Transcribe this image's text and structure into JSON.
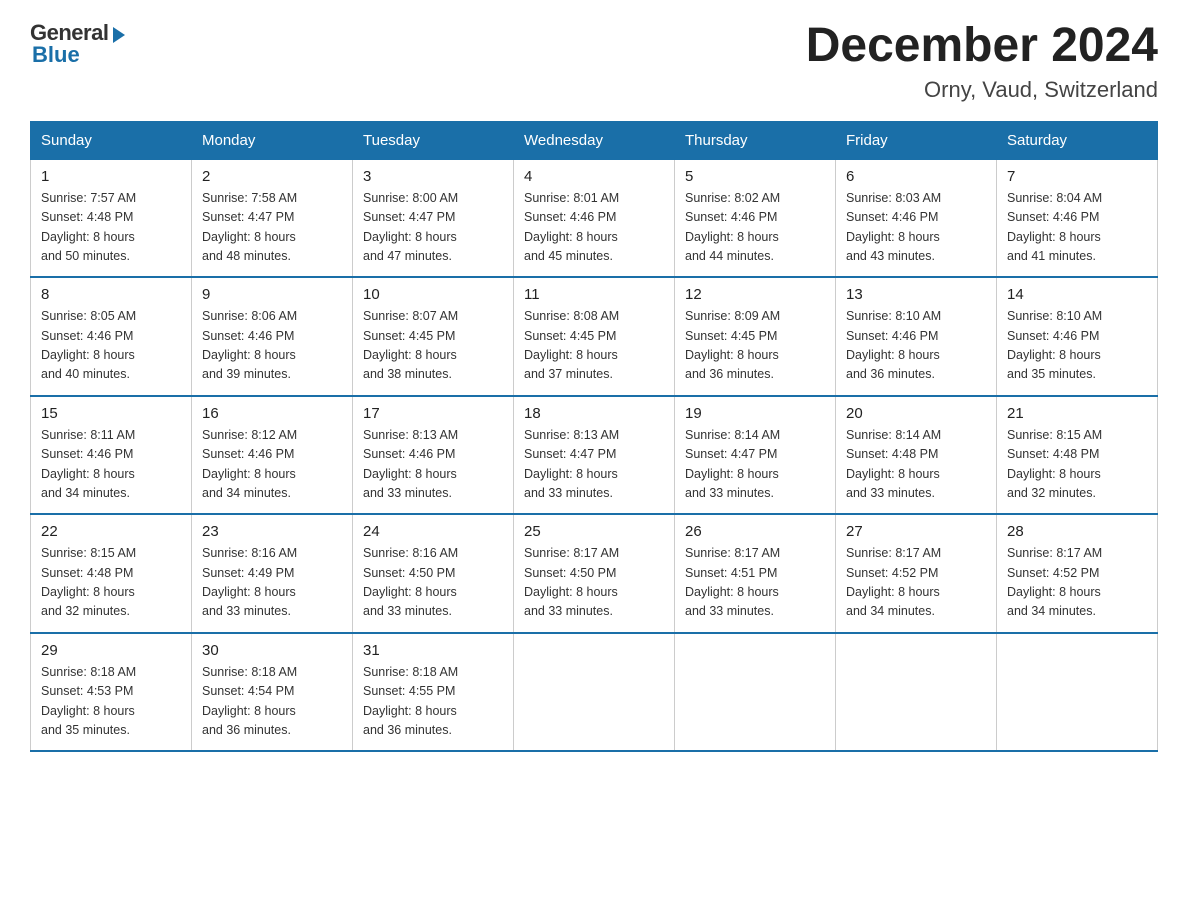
{
  "header": {
    "logo_general": "General",
    "logo_blue": "Blue",
    "title": "December 2024",
    "location": "Orny, Vaud, Switzerland"
  },
  "weekdays": [
    "Sunday",
    "Monday",
    "Tuesday",
    "Wednesday",
    "Thursday",
    "Friday",
    "Saturday"
  ],
  "weeks": [
    [
      {
        "day": "1",
        "sunrise": "7:57 AM",
        "sunset": "4:48 PM",
        "daylight": "8 hours and 50 minutes."
      },
      {
        "day": "2",
        "sunrise": "7:58 AM",
        "sunset": "4:47 PM",
        "daylight": "8 hours and 48 minutes."
      },
      {
        "day": "3",
        "sunrise": "8:00 AM",
        "sunset": "4:47 PM",
        "daylight": "8 hours and 47 minutes."
      },
      {
        "day": "4",
        "sunrise": "8:01 AM",
        "sunset": "4:46 PM",
        "daylight": "8 hours and 45 minutes."
      },
      {
        "day": "5",
        "sunrise": "8:02 AM",
        "sunset": "4:46 PM",
        "daylight": "8 hours and 44 minutes."
      },
      {
        "day": "6",
        "sunrise": "8:03 AM",
        "sunset": "4:46 PM",
        "daylight": "8 hours and 43 minutes."
      },
      {
        "day": "7",
        "sunrise": "8:04 AM",
        "sunset": "4:46 PM",
        "daylight": "8 hours and 41 minutes."
      }
    ],
    [
      {
        "day": "8",
        "sunrise": "8:05 AM",
        "sunset": "4:46 PM",
        "daylight": "8 hours and 40 minutes."
      },
      {
        "day": "9",
        "sunrise": "8:06 AM",
        "sunset": "4:46 PM",
        "daylight": "8 hours and 39 minutes."
      },
      {
        "day": "10",
        "sunrise": "8:07 AM",
        "sunset": "4:45 PM",
        "daylight": "8 hours and 38 minutes."
      },
      {
        "day": "11",
        "sunrise": "8:08 AM",
        "sunset": "4:45 PM",
        "daylight": "8 hours and 37 minutes."
      },
      {
        "day": "12",
        "sunrise": "8:09 AM",
        "sunset": "4:45 PM",
        "daylight": "8 hours and 36 minutes."
      },
      {
        "day": "13",
        "sunrise": "8:10 AM",
        "sunset": "4:46 PM",
        "daylight": "8 hours and 36 minutes."
      },
      {
        "day": "14",
        "sunrise": "8:10 AM",
        "sunset": "4:46 PM",
        "daylight": "8 hours and 35 minutes."
      }
    ],
    [
      {
        "day": "15",
        "sunrise": "8:11 AM",
        "sunset": "4:46 PM",
        "daylight": "8 hours and 34 minutes."
      },
      {
        "day": "16",
        "sunrise": "8:12 AM",
        "sunset": "4:46 PM",
        "daylight": "8 hours and 34 minutes."
      },
      {
        "day": "17",
        "sunrise": "8:13 AM",
        "sunset": "4:46 PM",
        "daylight": "8 hours and 33 minutes."
      },
      {
        "day": "18",
        "sunrise": "8:13 AM",
        "sunset": "4:47 PM",
        "daylight": "8 hours and 33 minutes."
      },
      {
        "day": "19",
        "sunrise": "8:14 AM",
        "sunset": "4:47 PM",
        "daylight": "8 hours and 33 minutes."
      },
      {
        "day": "20",
        "sunrise": "8:14 AM",
        "sunset": "4:48 PM",
        "daylight": "8 hours and 33 minutes."
      },
      {
        "day": "21",
        "sunrise": "8:15 AM",
        "sunset": "4:48 PM",
        "daylight": "8 hours and 32 minutes."
      }
    ],
    [
      {
        "day": "22",
        "sunrise": "8:15 AM",
        "sunset": "4:48 PM",
        "daylight": "8 hours and 32 minutes."
      },
      {
        "day": "23",
        "sunrise": "8:16 AM",
        "sunset": "4:49 PM",
        "daylight": "8 hours and 33 minutes."
      },
      {
        "day": "24",
        "sunrise": "8:16 AM",
        "sunset": "4:50 PM",
        "daylight": "8 hours and 33 minutes."
      },
      {
        "day": "25",
        "sunrise": "8:17 AM",
        "sunset": "4:50 PM",
        "daylight": "8 hours and 33 minutes."
      },
      {
        "day": "26",
        "sunrise": "8:17 AM",
        "sunset": "4:51 PM",
        "daylight": "8 hours and 33 minutes."
      },
      {
        "day": "27",
        "sunrise": "8:17 AM",
        "sunset": "4:52 PM",
        "daylight": "8 hours and 34 minutes."
      },
      {
        "day": "28",
        "sunrise": "8:17 AM",
        "sunset": "4:52 PM",
        "daylight": "8 hours and 34 minutes."
      }
    ],
    [
      {
        "day": "29",
        "sunrise": "8:18 AM",
        "sunset": "4:53 PM",
        "daylight": "8 hours and 35 minutes."
      },
      {
        "day": "30",
        "sunrise": "8:18 AM",
        "sunset": "4:54 PM",
        "daylight": "8 hours and 36 minutes."
      },
      {
        "day": "31",
        "sunrise": "8:18 AM",
        "sunset": "4:55 PM",
        "daylight": "8 hours and 36 minutes."
      },
      null,
      null,
      null,
      null
    ]
  ],
  "labels": {
    "sunrise": "Sunrise:",
    "sunset": "Sunset:",
    "daylight": "Daylight:"
  }
}
